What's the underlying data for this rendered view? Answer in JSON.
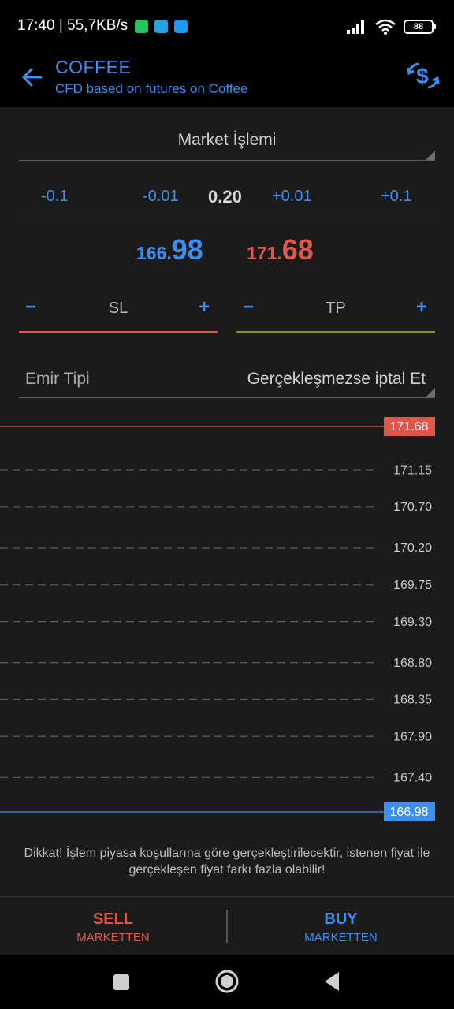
{
  "status_bar": {
    "time_speed": "17:40 | 55,7KB/s",
    "battery": "88",
    "icons": [
      "whatsapp-icon",
      "telegram-icon",
      "twitter-icon",
      "signal-icon",
      "wifi-icon",
      "battery-icon"
    ]
  },
  "header": {
    "title": "COFFEE",
    "subtitle": "CFD based on futures on Coffee",
    "icons": [
      "back-arrow-icon",
      "currency-exchange-icon"
    ]
  },
  "order_type": {
    "value": "Market İşlemi"
  },
  "quantity": {
    "minus_large": "-0.1",
    "minus_small": "-0.01",
    "value": "0.20",
    "plus_small": "+0.01",
    "plus_large": "+0.1"
  },
  "prices": {
    "bid": {
      "prefix": "166.",
      "suffix": "98"
    },
    "ask": {
      "prefix": "171.",
      "suffix": "68"
    }
  },
  "sl": {
    "label": "SL",
    "minus": "−",
    "plus": "+"
  },
  "tp": {
    "label": "TP",
    "minus": "−",
    "plus": "+"
  },
  "emir": {
    "label": "Emir Tipi",
    "value": "Gerçekleşmezse iptal Et"
  },
  "chart_data": {
    "type": "line",
    "title": "",
    "xlabel": "",
    "ylabel": "",
    "ask_line": {
      "value": 171.68,
      "label": "171.68",
      "color": "#e0564a"
    },
    "bid_line": {
      "value": 166.98,
      "label": "166.98",
      "color": "#3d8ef0"
    },
    "levels": [
      {
        "value": 171.15,
        "label": "171.15"
      },
      {
        "value": 170.7,
        "label": "170.70"
      },
      {
        "value": 170.2,
        "label": "170.20"
      },
      {
        "value": 169.75,
        "label": "169.75"
      },
      {
        "value": 169.3,
        "label": "169.30"
      },
      {
        "value": 168.8,
        "label": "168.80"
      },
      {
        "value": 168.35,
        "label": "168.35"
      },
      {
        "value": 167.9,
        "label": "167.90"
      },
      {
        "value": 167.4,
        "label": "167.40"
      }
    ],
    "ylim": [
      166.98,
      171.68
    ]
  },
  "disclaimer": "Dikkat! İşlem piyasa koşullarına göre gerçekleştirilecektir, istenen fiyat ile gerçekleşen fiyat farkı fazla olabilir!",
  "actions": {
    "sell": {
      "label": "SELL",
      "sub": "MARKETTEN"
    },
    "buy": {
      "label": "BUY",
      "sub": "MARKETTEN"
    }
  },
  "nav": {
    "icons": [
      "recent-apps-icon",
      "home-icon",
      "back-icon"
    ]
  },
  "colors": {
    "accent": "#3d8ef0",
    "sell": "#e0564a",
    "tp": "#7a9a2a",
    "background": "#1b1b1b"
  }
}
